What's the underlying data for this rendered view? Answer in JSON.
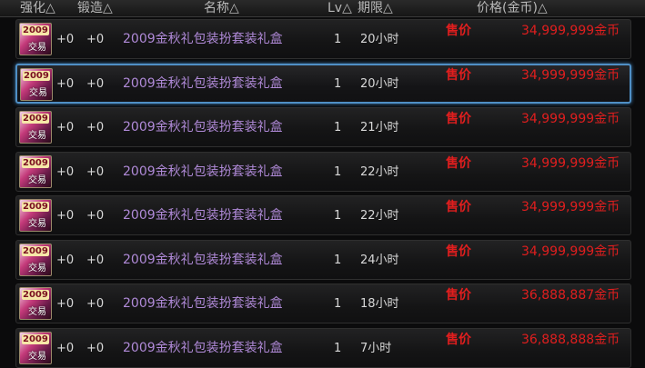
{
  "header": {
    "enhance": "强化△",
    "forge": "锻造△",
    "name": "名称△",
    "lv": "Lv△",
    "expire": "期限△",
    "price": "价格(金币)△"
  },
  "icon": {
    "year": "2009",
    "trade": "交易"
  },
  "rows": [
    {
      "enhance": "+0",
      "forge": "+0",
      "name": "2009金秋礼包装扮套装礼盒",
      "lv": "1",
      "expire": "20小时",
      "sell": "售价",
      "price": "34,999,999金币"
    },
    {
      "enhance": "+0",
      "forge": "+0",
      "name": "2009金秋礼包装扮套装礼盒",
      "lv": "1",
      "expire": "20小时",
      "sell": "售价",
      "price": "34,999,999金币"
    },
    {
      "enhance": "+0",
      "forge": "+0",
      "name": "2009金秋礼包装扮套装礼盒",
      "lv": "1",
      "expire": "21小时",
      "sell": "售价",
      "price": "34,999,999金币"
    },
    {
      "enhance": "+0",
      "forge": "+0",
      "name": "2009金秋礼包装扮套装礼盒",
      "lv": "1",
      "expire": "22小时",
      "sell": "售价",
      "price": "34,999,999金币"
    },
    {
      "enhance": "+0",
      "forge": "+0",
      "name": "2009金秋礼包装扮套装礼盒",
      "lv": "1",
      "expire": "22小时",
      "sell": "售价",
      "price": "34,999,999金币"
    },
    {
      "enhance": "+0",
      "forge": "+0",
      "name": "2009金秋礼包装扮套装礼盒",
      "lv": "1",
      "expire": "24小时",
      "sell": "售价",
      "price": "34,999,999金币"
    },
    {
      "enhance": "+0",
      "forge": "+0",
      "name": "2009金秋礼包装扮套装礼盒",
      "lv": "1",
      "expire": "18小时",
      "sell": "售价",
      "price": "36,888,887金币"
    },
    {
      "enhance": "+0",
      "forge": "+0",
      "name": "2009金秋礼包装扮套装礼盒",
      "lv": "1",
      "expire": "7小时",
      "sell": "售价",
      "price": "36,888,888金币"
    }
  ]
}
